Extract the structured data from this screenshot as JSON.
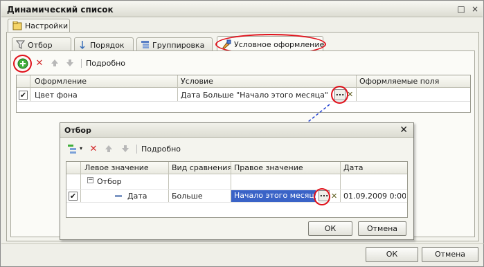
{
  "window": {
    "title": "Динамический список",
    "buttons": {
      "close": "×",
      "maximize": "□"
    }
  },
  "panel_tab": "Настройки",
  "tabs": [
    {
      "label": "Отбор",
      "icon": "filter-icon"
    },
    {
      "label": "Порядок",
      "icon": "sort-icon"
    },
    {
      "label": "Группировка",
      "icon": "group-icon"
    },
    {
      "label": "Условное оформление",
      "icon": "brush-icon"
    }
  ],
  "toolbar": {
    "details_label": "Подробно"
  },
  "grid": {
    "columns": [
      "Оформление",
      "Условие",
      "Оформляемые поля"
    ],
    "rows": [
      {
        "checked": true,
        "design": "Цвет фона",
        "condition": "Дата Больше \"Начало этого месяца\"",
        "fields": ""
      }
    ]
  },
  "dialog": {
    "title": "Отбор",
    "toolbar": {
      "details_label": "Подробно"
    },
    "columns": [
      "Левое значение",
      "Вид сравнения",
      "Правое значение",
      "Дата"
    ],
    "group": {
      "label": "Отбор"
    },
    "rows": [
      {
        "checked": true,
        "left": "Дата",
        "comparison": "Больше",
        "right": "Начало этого месяца",
        "date": "01.09.2009 0:00..."
      }
    ],
    "ok_label": "ОК",
    "cancel_label": "Отмена"
  },
  "footer": {
    "ok_label": "ОК",
    "cancel_label": "Отмена"
  },
  "colors": {
    "highlight_ring": "#e0101a",
    "selection": "#3a63c7",
    "arrow": "#1f3fd0"
  }
}
